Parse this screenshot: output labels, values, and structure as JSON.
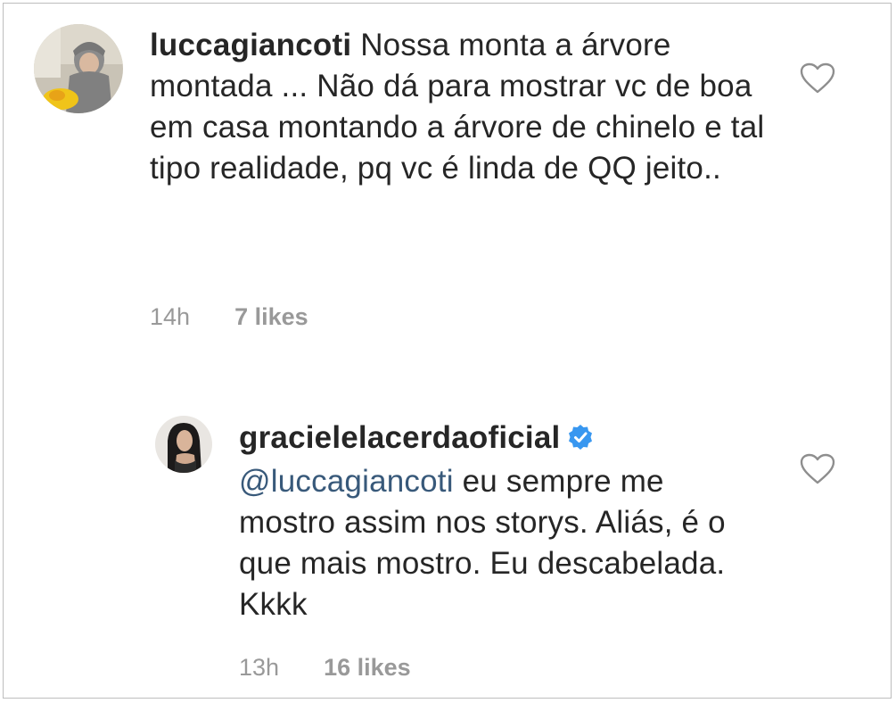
{
  "comments": [
    {
      "username": "luccagiancoti",
      "text": " Nossa monta a árvore montada ... Não dá para mostrar vc de boa em casa montando a árvore de chinelo e tal tipo realidade, pq vc é linda de QQ jeito..",
      "time": "14h",
      "likes": "7 likes",
      "avatar_icon": "baby-photo-avatar",
      "like_icon": "heart-outline-icon"
    },
    {
      "username": "gracielelacerdaoficial",
      "verified": true,
      "mention": "@luccagiancoti",
      "text": " eu sempre me mostro assim nos storys. Aliás, é o que mais mostro. Eu descabelada. Kkkk",
      "time": "13h",
      "likes": "16 likes",
      "avatar_icon": "woman-photo-avatar",
      "like_icon": "heart-outline-icon"
    }
  ],
  "colors": {
    "text": "#262626",
    "meta": "#999999",
    "mention": "#38597a",
    "verified": "#3897f0",
    "border": "#bdbdbd"
  }
}
